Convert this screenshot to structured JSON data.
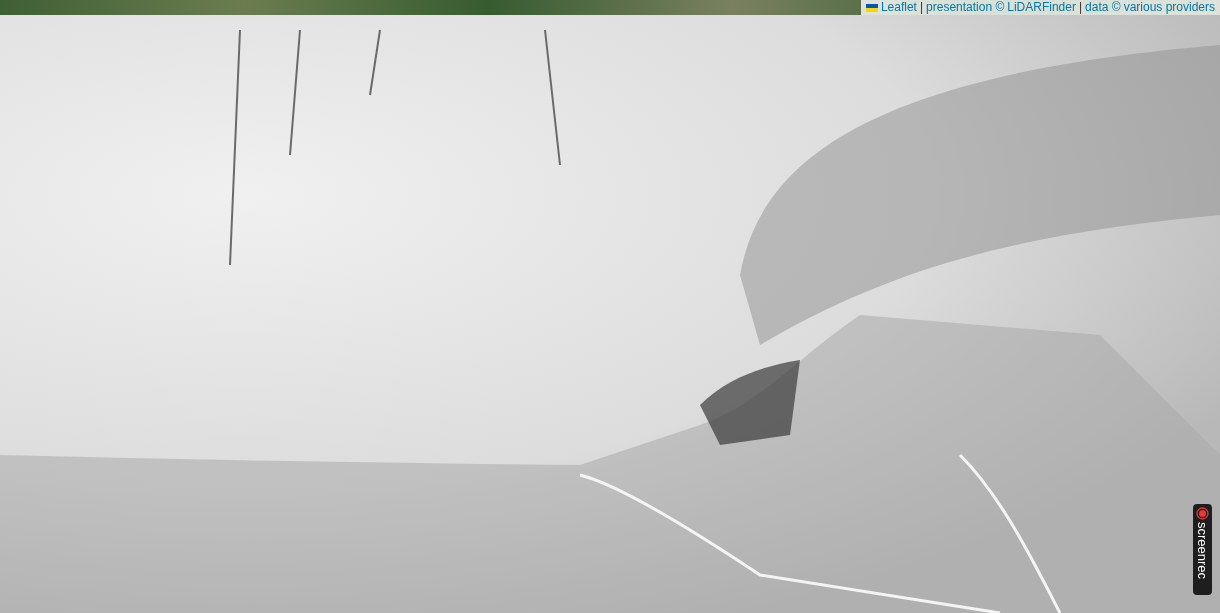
{
  "map": {
    "attribution": [
      {
        "kind": "link",
        "text": "Leaflet"
      },
      {
        "kind": "separator",
        "text": "|"
      },
      {
        "kind": "text",
        "text": "presentation ©"
      },
      {
        "kind": "link",
        "text": "LiDARFinder"
      },
      {
        "kind": "separator",
        "text": "|"
      },
      {
        "kind": "text",
        "text": "data ©"
      },
      {
        "kind": "link",
        "text": "various providers"
      }
    ]
  },
  "recorder_badge": {
    "label": "screenrec"
  }
}
